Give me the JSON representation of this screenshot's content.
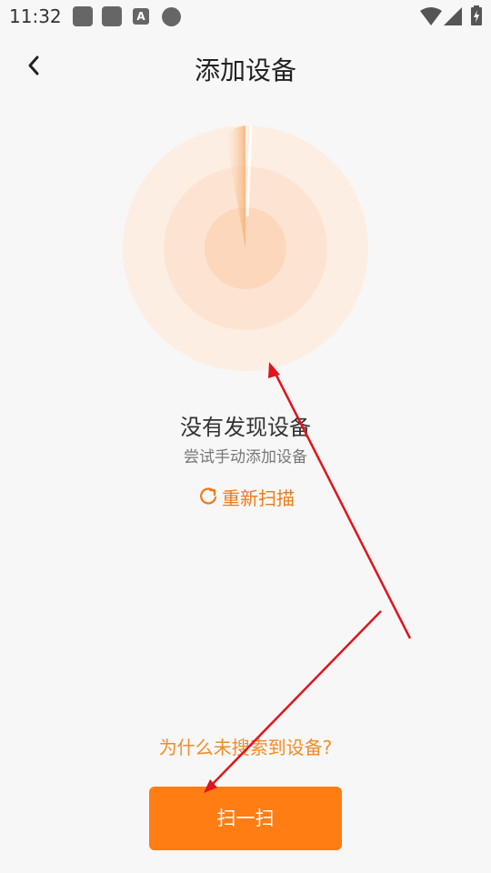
{
  "status_bar": {
    "time": "11:32",
    "notif_a": "A"
  },
  "header": {
    "title": "添加设备"
  },
  "empty_state": {
    "title": "没有发现设备",
    "subtitle": "尝试手动添加设备",
    "rescan_label": "重新扫描"
  },
  "help_link": "为什么未搜索到设备?",
  "scan_button_label": "扫一扫",
  "colors": {
    "accent": "#ff7d12",
    "annotation": "#e0141b",
    "radar": "#fde4d0"
  }
}
